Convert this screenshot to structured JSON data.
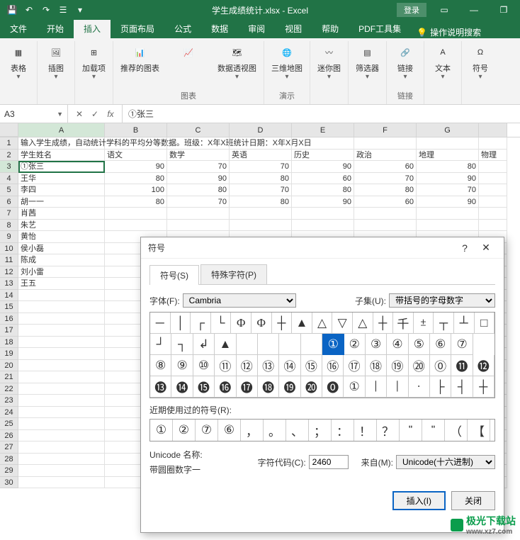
{
  "titlebar": {
    "title": "学生成绩统计.xlsx - Excel",
    "login": "登录",
    "qat_icons": [
      "save-icon",
      "undo-icon",
      "redo-icon",
      "touch-icon",
      "dropdown-icon"
    ]
  },
  "tabs": {
    "file": "文件",
    "home": "开始",
    "insert": "插入",
    "layout": "页面布局",
    "formulas": "公式",
    "data": "数据",
    "review": "审阅",
    "view": "视图",
    "help": "帮助",
    "pdf": "PDF工具集",
    "tell": "操作说明搜索"
  },
  "ribbon": {
    "tables": "表格",
    "illustrations": "插图",
    "addins_btn": "加载项",
    "addins": "加载项",
    "rec_charts": "推荐的图表",
    "charts": "图表",
    "pivotchart": "数据透视图",
    "map3d_btn": "三维地图",
    "map3d": "演示",
    "sparklines": "迷你图",
    "filters": "筛选器",
    "links_btn": "链接",
    "links": "链接",
    "text": "文本",
    "symbols": "符号"
  },
  "fbar": {
    "name": "A3",
    "formula": "①张三",
    "fx": "fx"
  },
  "cols": [
    "A",
    "B",
    "C",
    "D",
    "E",
    "F",
    "G",
    ""
  ],
  "sheet": {
    "r1": "输入学生成绩，自动统计学科的平均分等数据。班级：X年X班统计日期：X年X月X日",
    "headers": [
      "学生姓名",
      "语文",
      "数学",
      "英语",
      "历史",
      "政治",
      "地理",
      "物理"
    ],
    "rows": [
      {
        "name": "①张三",
        "v": [
          90,
          70,
          70,
          90,
          60,
          80
        ]
      },
      {
        "name": "王华",
        "v": [
          80,
          90,
          80,
          60,
          70,
          90
        ]
      },
      {
        "name": "李四",
        "v": [
          100,
          80,
          70,
          80,
          80,
          70
        ]
      },
      {
        "name": "胡一一",
        "v": [
          80,
          70,
          80,
          90,
          60,
          90
        ]
      },
      {
        "name": "肖茜",
        "v": [
          "",
          "",
          "",
          "",
          "",
          ""
        ]
      },
      {
        "name": "朱艺",
        "v": [
          "",
          "",
          "",
          "",
          "",
          ""
        ]
      },
      {
        "name": "黄怡",
        "v": [
          "",
          "",
          "",
          "",
          "",
          ""
        ]
      },
      {
        "name": "侯小磊",
        "v": [
          "",
          "",
          "",
          "",
          "",
          ""
        ]
      },
      {
        "name": "陈成",
        "v": [
          "",
          "",
          "",
          "",
          "",
          ""
        ]
      },
      {
        "name": "刘小雷",
        "v": [
          "",
          "",
          "",
          "",
          "",
          ""
        ]
      },
      {
        "name": "王五",
        "v": [
          "",
          "",
          "",
          "",
          "",
          ""
        ]
      }
    ]
  },
  "dialog": {
    "title": "符号",
    "tab_symbol": "符号(S)",
    "tab_special": "特殊字符(P)",
    "font_label": "字体(F):",
    "font_value": "Cambria",
    "subset_label": "子集(U):",
    "subset_value": "带括号的字母数字",
    "grid_rows": [
      [
        "─",
        "│",
        "┌",
        "└",
        "Φ",
        "Φ",
        "┼",
        "▲",
        "△",
        "▽",
        "△",
        "┼",
        "千",
        "±",
        "┬",
        "┴",
        "□"
      ],
      [
        "┘",
        "┐",
        "↲",
        "▲",
        "",
        "",
        "",
        "",
        "①",
        "②",
        "③",
        "④",
        "⑤",
        "⑥",
        "⑦"
      ],
      [
        "⑧",
        "⑨",
        "⑩",
        "⑪",
        "⑫",
        "⑬",
        "⑭",
        "⑮",
        "⑯",
        "⑰",
        "⑱",
        "⑲",
        "⑳",
        "⓪",
        "⓫",
        "⓬"
      ],
      [
        "⓭",
        "⓮",
        "⓯",
        "⓰",
        "⓱",
        "⓲",
        "⓳",
        "⓴",
        "⓿",
        "①",
        "|",
        "|",
        "·",
        "├",
        "┤",
        "┼"
      ]
    ],
    "selected_index": [
      1,
      8
    ],
    "recent_label": "近期使用过的符号(R):",
    "recent": [
      "①",
      "②",
      "⑦",
      "⑥",
      "，",
      "。",
      "、",
      "；",
      "：",
      "！",
      "？",
      "\"",
      "\"",
      "（",
      "【"
    ],
    "uname_label": "Unicode 名称:",
    "uname_value": "带圆圈数字一",
    "code_label": "字符代码(C):",
    "code_value": "2460",
    "from_label": "来自(M):",
    "from_value": "Unicode(十六进制)",
    "insert_btn": "插入(I)",
    "close_btn": "关闭"
  },
  "watermark": {
    "site": "极光下载站",
    "url": "www.xz7.com"
  }
}
